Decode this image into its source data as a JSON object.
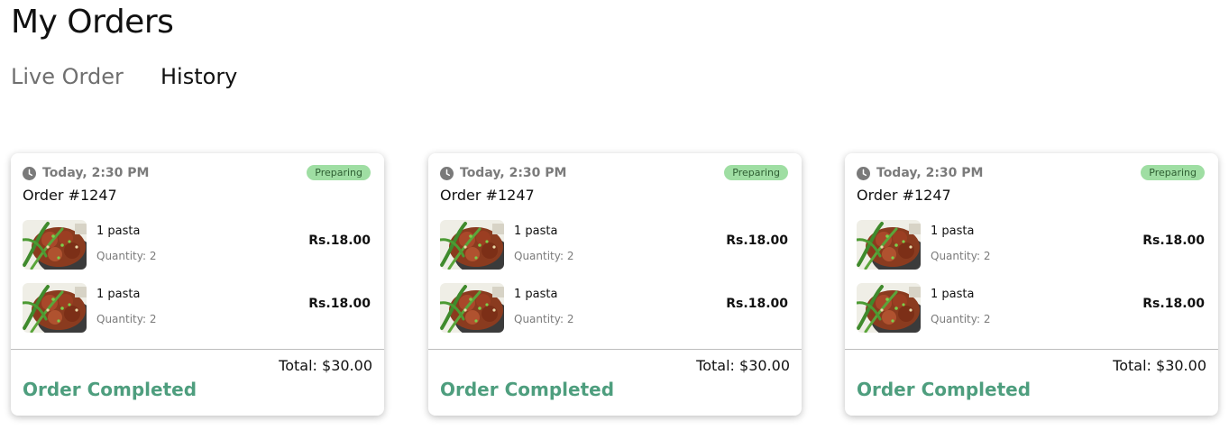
{
  "page": {
    "title": "My Orders"
  },
  "tabs": [
    {
      "label": "Live Order",
      "active": false
    },
    {
      "label": "History",
      "active": true
    }
  ],
  "colors": {
    "status_badge_bg": "#9fdea3",
    "completed_text": "#4e9e7e",
    "muted_text": "#7b7b7b"
  },
  "orders": [
    {
      "time": "Today, 2:30 PM",
      "status": "Preparing",
      "order_number": "Order #1247",
      "items": [
        {
          "name": "1 pasta",
          "quantity": "Quantity: 2",
          "price": "Rs.18.00",
          "image_icon": "food-image"
        },
        {
          "name": "1 pasta",
          "quantity": "Quantity: 2",
          "price": "Rs.18.00",
          "image_icon": "food-image"
        }
      ],
      "total": "Total: $30.00",
      "completed_label": "Order Completed"
    },
    {
      "time": "Today, 2:30 PM",
      "status": "Preparing",
      "order_number": "Order #1247",
      "items": [
        {
          "name": "1 pasta",
          "quantity": "Quantity: 2",
          "price": "Rs.18.00",
          "image_icon": "food-image"
        },
        {
          "name": "1 pasta",
          "quantity": "Quantity: 2",
          "price": "Rs.18.00",
          "image_icon": "food-image"
        }
      ],
      "total": "Total: $30.00",
      "completed_label": "Order Completed"
    },
    {
      "time": "Today, 2:30 PM",
      "status": "Preparing",
      "order_number": "Order #1247",
      "items": [
        {
          "name": "1 pasta",
          "quantity": "Quantity: 2",
          "price": "Rs.18.00",
          "image_icon": "food-image"
        },
        {
          "name": "1 pasta",
          "quantity": "Quantity: 2",
          "price": "Rs.18.00",
          "image_icon": "food-image"
        }
      ],
      "total": "Total: $30.00",
      "completed_label": "Order Completed"
    }
  ]
}
